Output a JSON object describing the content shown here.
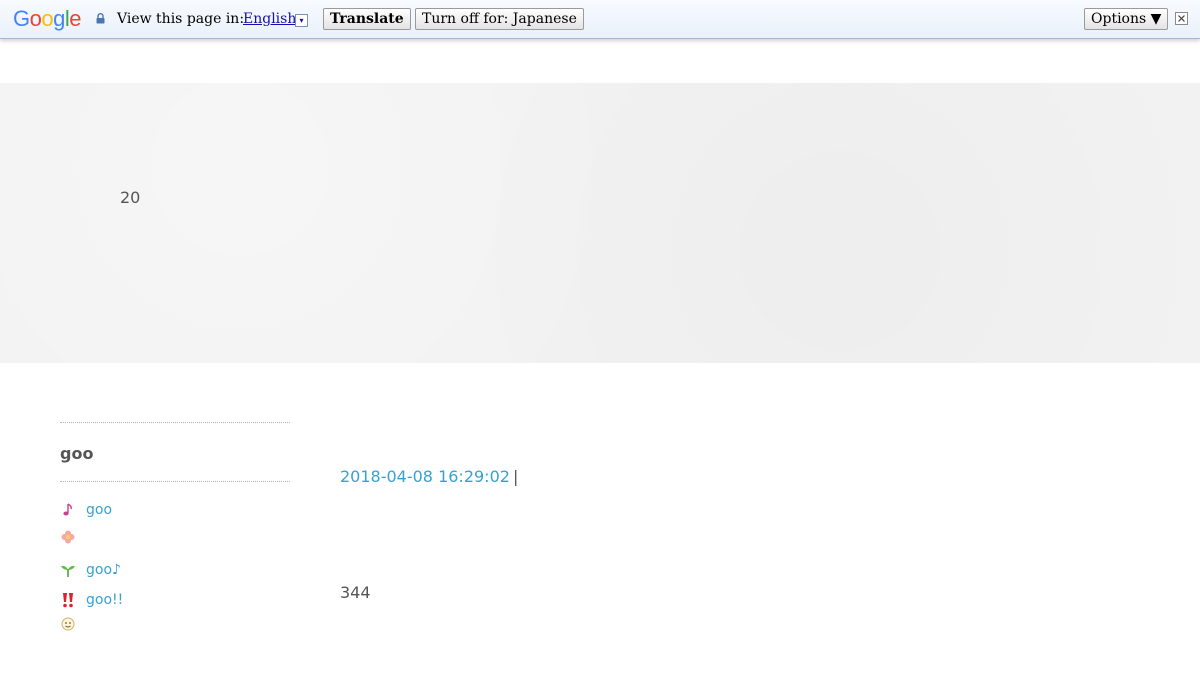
{
  "translate_bar": {
    "logo_letters": [
      "G",
      "o",
      "o",
      "g",
      "l",
      "e"
    ],
    "view_label": "View this page in:",
    "language": "English",
    "dropdown_glyph": "▾",
    "translate_label": "Translate",
    "turn_off_label": "Turn off for: Japanese",
    "options_label": "Options ▼",
    "icons": {
      "lock": "lock-icon",
      "close": "close-icon"
    }
  },
  "header": {
    "text": "20"
  },
  "sidebar": {
    "title": "goo",
    "items": [
      {
        "icon": "music-note-icon",
        "label": "goo"
      },
      {
        "icon": "flower-icon",
        "label": ""
      },
      {
        "icon": "sprout-icon",
        "label": "goo♪"
      },
      {
        "icon": "double-exclamation-icon",
        "label": "goo!!"
      },
      {
        "icon": "smiley-icon",
        "label": ""
      }
    ]
  },
  "post": {
    "date": "2018-04-08 16:29:02",
    "separator": "|",
    "count": "344"
  },
  "colors": {
    "link": "#35a3d2",
    "text": "#555555",
    "banner": "#f2f2f2"
  }
}
